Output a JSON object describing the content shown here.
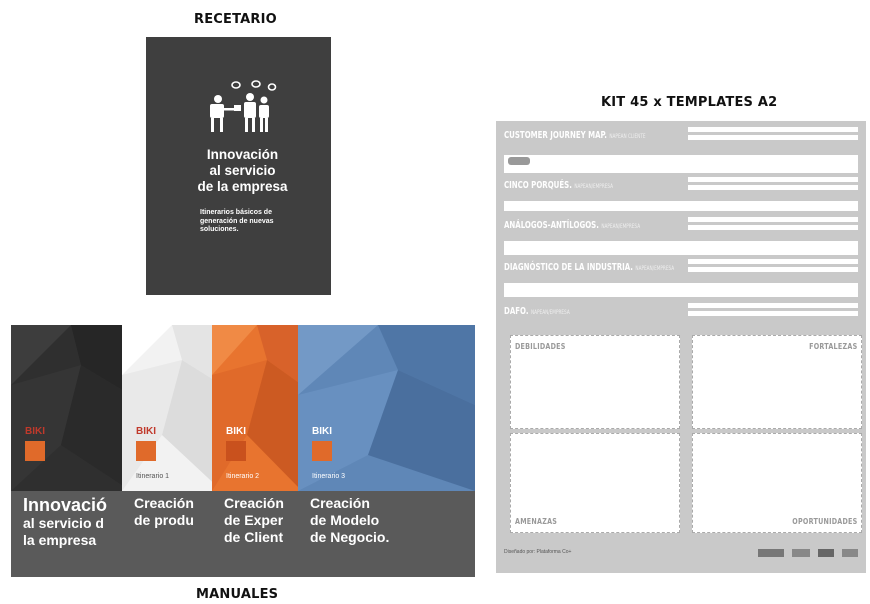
{
  "labels": {
    "recetario": "RECETARIO",
    "kit": "KIT 45 x TEMPLATES A2",
    "manuales": "MANUALES"
  },
  "recetario": {
    "title": [
      "Innovación",
      "al servicio",
      "de la empresa"
    ],
    "subtitle": [
      "Itinerarios básicos de",
      "generación de nuevas",
      "soluciones."
    ]
  },
  "manuals": [
    {
      "title": [
        "Innovació",
        "al servicio d",
        "la empresa"
      ],
      "itinerary": ""
    },
    {
      "title": [
        "Creación",
        "de produ"
      ],
      "itinerary": "Itinerario 1"
    },
    {
      "title": [
        "Creación",
        "de Exper",
        "de Client"
      ],
      "itinerary": "Itinerario 2"
    },
    {
      "title": [
        "Creación",
        "de Modelo",
        "de Negocio."
      ],
      "itinerary": "Itinerario 3"
    }
  ],
  "manual_logo": "BIKI",
  "kit": {
    "templates": [
      {
        "title": "CUSTOMER JOURNEY MAP.",
        "sub": "NAPEAN CLIENTE"
      },
      {
        "title": "CINCO PORQUÉS.",
        "sub": "NAPEAN/EMPRESA"
      },
      {
        "title": "ANÁLOGOS-ANTÍLOGOS.",
        "sub": "NAPEAN/EMPRESA"
      },
      {
        "title": "DIAGNÓSTICO DE LA INDUSTRIA.",
        "sub": "NAPEAN/EMPRESA"
      },
      {
        "title": "DAFO.",
        "sub": "NAPEAN/EMPRESA"
      }
    ],
    "dafo": {
      "q1": "DEBILIDADES",
      "q2": "FORTALEZAS",
      "q3": "AMENAZAS",
      "q4": "OPORTUNIDADES"
    },
    "footer": "Diseñado por: Plataforma Co+"
  }
}
